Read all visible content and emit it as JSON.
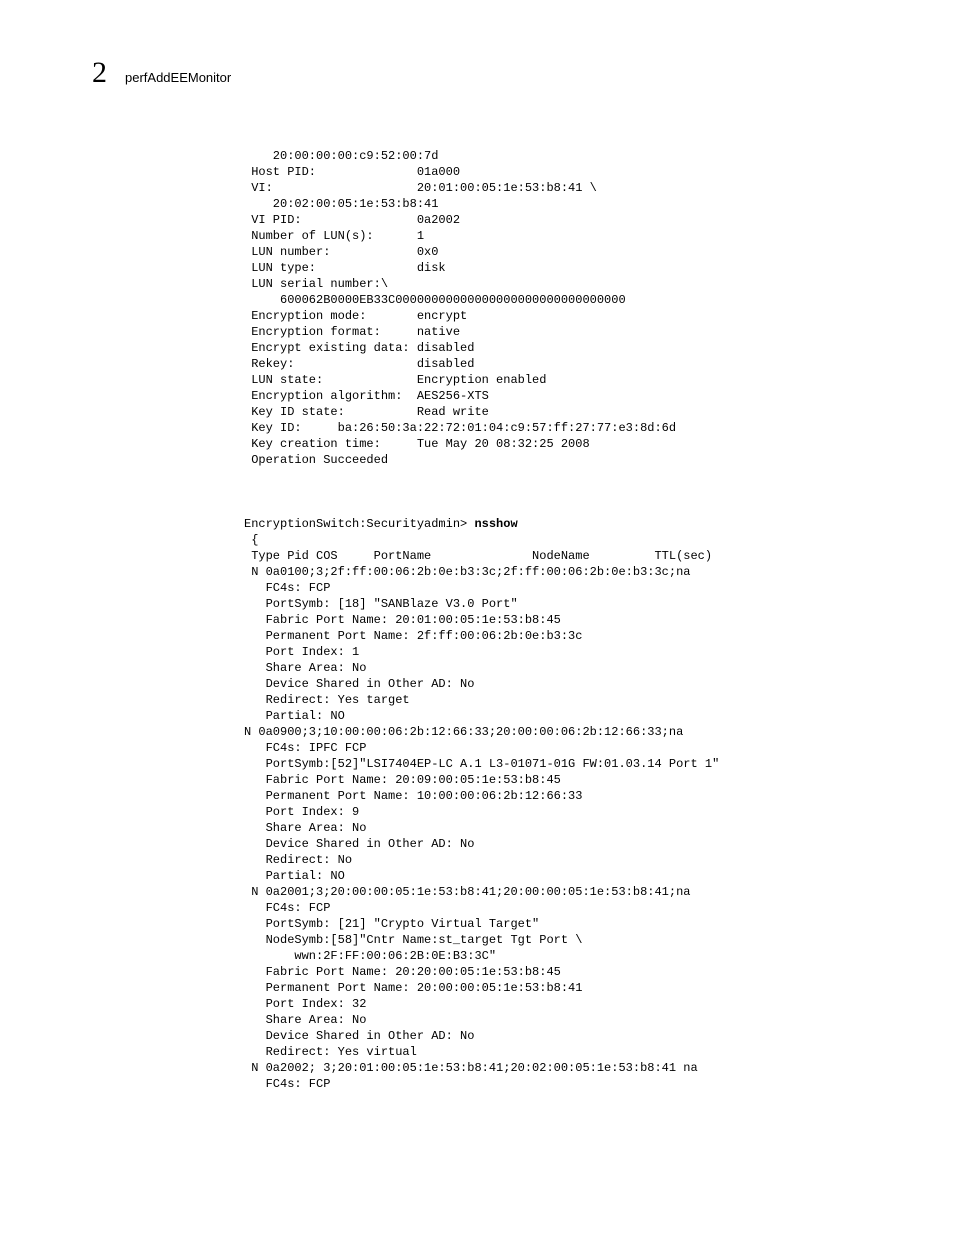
{
  "header": {
    "chapter_number": "2",
    "title": "perfAddEEMonitor"
  },
  "block1": "    20:00:00:00:c9:52:00:7d\n Host PID:              01a000\n VI:                    20:01:00:05:1e:53:b8:41 \\\n    20:02:00:05:1e:53:b8:41\n VI PID:                0a2002\n Number of LUN(s):      1\n LUN number:            0x0\n LUN type:              disk\n LUN serial number:\\\n     600062B0000EB33C00000000000000000000000000000000\n Encryption mode:       encrypt\n Encryption format:     native\n Encrypt existing data: disabled\n Rekey:                 disabled\n LUN state:             Encryption enabled\n Encryption algorithm:  AES256-XTS\n Key ID state:          Read write\n Key ID:     ba:26:50:3a:22:72:01:04:c9:57:ff:27:77:e3:8d:6d\n Key creation time:     Tue May 20 08:32:25 2008\n Operation Succeeded",
  "prompt_line": {
    "prefix": "EncryptionSwitch:Securityadmin> ",
    "command": "nsshow"
  },
  "block2": " {\n Type Pid COS     PortName              NodeName         TTL(sec)\n N 0a0100;3;2f:ff:00:06:2b:0e:b3:3c;2f:ff:00:06:2b:0e:b3:3c;na\n   FC4s: FCP\n   PortSymb: [18] \"SANBlaze V3.0 Port\"\n   Fabric Port Name: 20:01:00:05:1e:53:b8:45\n   Permanent Port Name: 2f:ff:00:06:2b:0e:b3:3c\n   Port Index: 1\n   Share Area: No\n   Device Shared in Other AD: No\n   Redirect: Yes target\n   Partial: NO\nN 0a0900;3;10:00:00:06:2b:12:66:33;20:00:00:06:2b:12:66:33;na\n   FC4s: IPFC FCP\n   PortSymb:[52]\"LSI7404EP-LC A.1 L3-01071-01G FW:01.03.14 Port 1\"\n   Fabric Port Name: 20:09:00:05:1e:53:b8:45\n   Permanent Port Name: 10:00:00:06:2b:12:66:33\n   Port Index: 9\n   Share Area: No\n   Device Shared in Other AD: No\n   Redirect: No\n   Partial: NO\n N 0a2001;3;20:00:00:05:1e:53:b8:41;20:00:00:05:1e:53:b8:41;na\n   FC4s: FCP\n   PortSymb: [21] \"Crypto Virtual Target\"\n   NodeSymb:[58]\"Cntr Name:st_target Tgt Port \\\n       wwn:2F:FF:00:06:2B:0E:B3:3C\"\n   Fabric Port Name: 20:20:00:05:1e:53:b8:45\n   Permanent Port Name: 20:00:00:05:1e:53:b8:41\n   Port Index: 32\n   Share Area: No\n   Device Shared in Other AD: No\n   Redirect: Yes virtual\n N 0a2002; 3;20:01:00:05:1e:53:b8:41;20:02:00:05:1e:53:b8:41 na\n   FC4s: FCP"
}
